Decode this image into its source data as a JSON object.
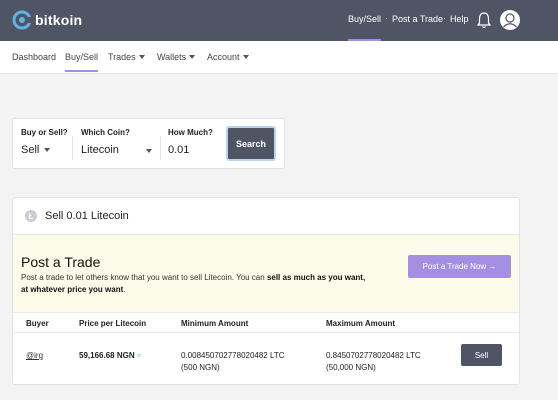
{
  "brand": {
    "name": "bitkoin",
    "logo_icon": "bitkoin-logo-icon"
  },
  "topnav": {
    "buy_sell": "Buy/Sell",
    "post_trade": "Post a Trade",
    "help": "Help",
    "separator": "·",
    "bell_icon": "bell-icon",
    "avatar_icon": "user-avatar-icon"
  },
  "subnav": {
    "dashboard": "Dashboard",
    "buy_sell": "Buy/Sell",
    "trades": "Trades",
    "wallets": "Wallets",
    "account": "Account"
  },
  "search": {
    "buy_or_sell_label": "Buy or Sell?",
    "buy_or_sell_value": "Sell",
    "coin_label": "Which Coin?",
    "coin_value": "Litecoin",
    "amount_label": "How Much?",
    "amount_value": "0.01",
    "button": "Search"
  },
  "card": {
    "coin_icon": "litecoin-icon",
    "coin_symbol": "Ł",
    "title": "Sell 0.01 Litecoin"
  },
  "post": {
    "title": "Post a Trade",
    "desc_prefix": "Post a trade to let others know that you want to sell Litecoin. You can ",
    "desc_bold": "sell as much as you want, at whatever price you want",
    "desc_suffix": ".",
    "button": "Post a Trade Now →"
  },
  "table": {
    "headers": [
      "Buyer",
      "Price per Litecoin",
      "Minimum Amount",
      "Maximum Amount"
    ],
    "rows": [
      {
        "buyer": "@irg",
        "price": "59,166.68 NGN",
        "price_icon": "≈",
        "min_ltc": "0.008450702778020482 LTC",
        "min_ngn": "(500 NGN)",
        "max_ltc": "0.8450702778020482 LTC",
        "max_ngn": "(50,000 NGN)",
        "action": "Sell"
      }
    ]
  },
  "colors": {
    "topbar": "#4f5565",
    "accent": "#a58fe3",
    "post_panel": "#fdfbe9",
    "price_icon": "#5bc0de"
  }
}
